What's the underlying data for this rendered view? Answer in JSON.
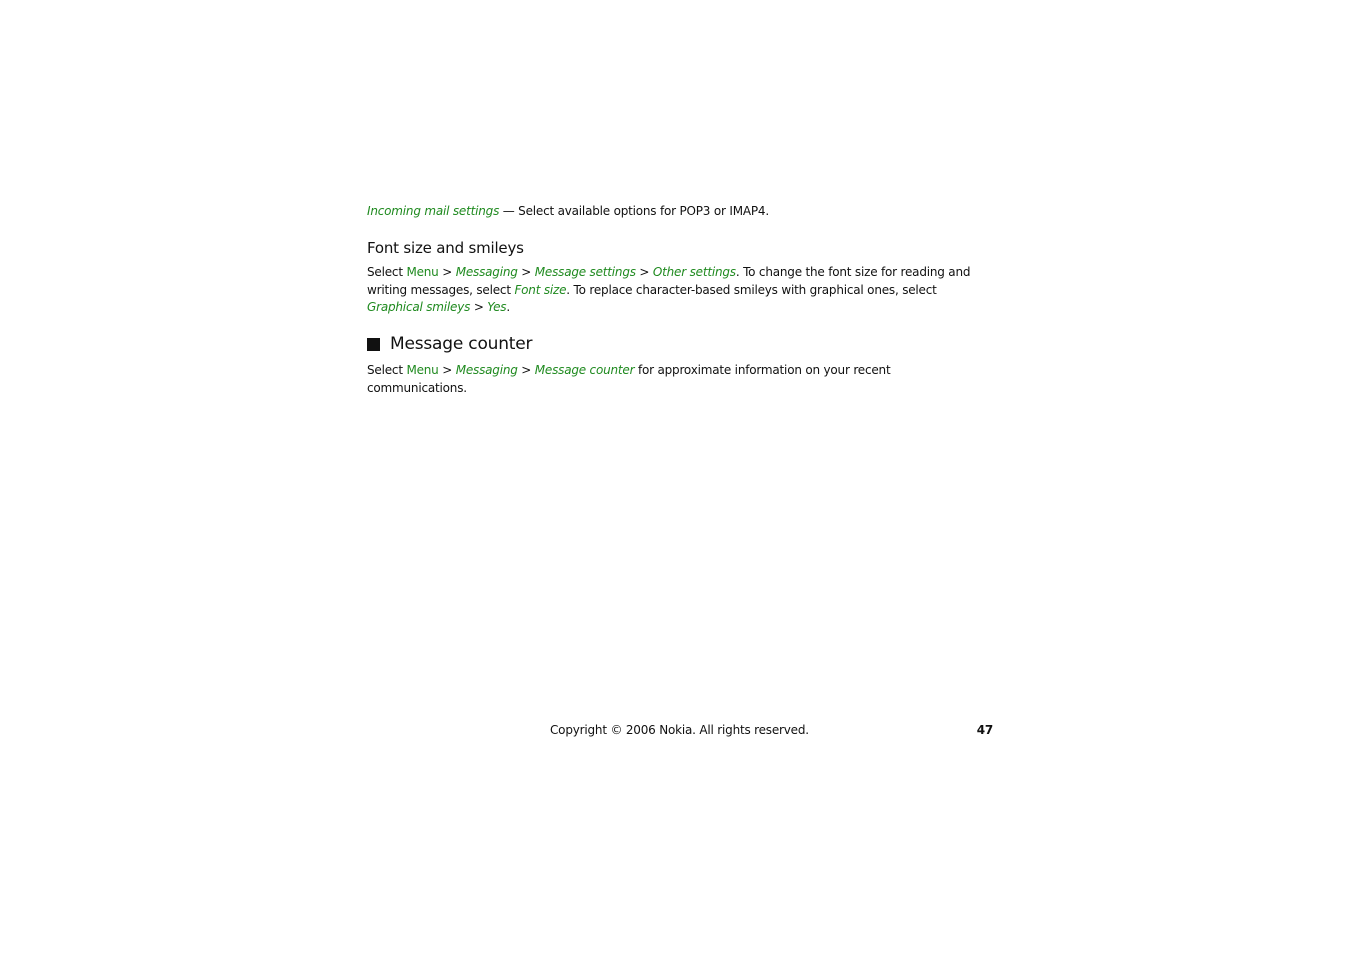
{
  "document": {
    "incoming": {
      "term": "Incoming mail settings",
      "description": " — Select available options for POP3 or IMAP4."
    },
    "font_section": {
      "heading": "Font size and smileys",
      "select": "Select ",
      "menu": "Menu",
      "sep": " > ",
      "path": [
        "Messaging",
        "Message settings",
        "Other settings"
      ],
      "text1": ". To change the font size for reading and writing messages, select ",
      "font_size": "Font size",
      "text2": ". To replace character-based smileys with graphical ones, select ",
      "graphical_smileys": "Graphical smileys",
      "yes": "Yes",
      "end": "."
    },
    "counter_section": {
      "heading": "Message counter",
      "select": "Select ",
      "menu": "Menu",
      "sep": " > ",
      "path": [
        "Messaging",
        "Message counter"
      ],
      "text": " for approximate information on your recent communications."
    },
    "footer": {
      "copyright": "Copyright © 2006 Nokia. All rights reserved.",
      "page_number": "47"
    }
  }
}
